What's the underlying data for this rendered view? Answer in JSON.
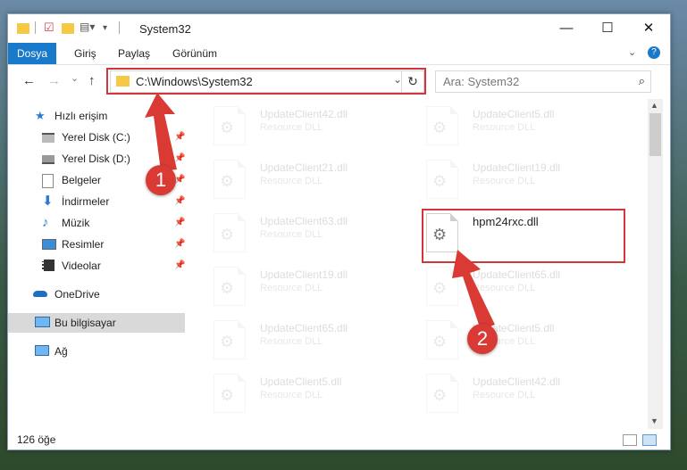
{
  "window": {
    "title": "System32",
    "controls": {
      "minimize": "—",
      "maximize": "☐",
      "close": "✕"
    }
  },
  "ribbon": {
    "tabs": [
      "Dosya",
      "Giriş",
      "Paylaş",
      "Görünüm"
    ],
    "expand_icon": "chevron-down-icon",
    "help_icon": "?"
  },
  "navigation": {
    "back": "←",
    "forward": "→",
    "recent": "⌄",
    "up": "↑",
    "address": "C:\\Windows\\System32",
    "address_dropdown": "⌄",
    "refresh": "↻",
    "search_placeholder": "Ara: System32"
  },
  "sidebar": {
    "items": [
      {
        "label": "Hızlı erişim",
        "icon": "star-icon",
        "pinned": false
      },
      {
        "label": "Yerel Disk (C:)",
        "icon": "drive-icon",
        "pinned": true
      },
      {
        "label": "Yerel Disk (D:)",
        "icon": "drive-icon",
        "pinned": true
      },
      {
        "label": "Belgeler",
        "icon": "documents-icon",
        "pinned": true
      },
      {
        "label": "İndirmeler",
        "icon": "download-icon",
        "pinned": true
      },
      {
        "label": "Müzik",
        "icon": "music-icon",
        "pinned": true
      },
      {
        "label": "Resimler",
        "icon": "pictures-icon",
        "pinned": true
      },
      {
        "label": "Videolar",
        "icon": "video-icon",
        "pinned": true
      },
      {
        "label": "OneDrive",
        "icon": "cloud-icon",
        "pinned": false
      },
      {
        "label": "Bu bilgisayar",
        "icon": "computer-icon",
        "pinned": false,
        "selected": true
      },
      {
        "label": "Ağ",
        "icon": "network-icon",
        "pinned": false
      }
    ]
  },
  "files": {
    "left_column": [
      {
        "name": "UpdateClient42.dll",
        "type": "Resource DLL"
      },
      {
        "name": "UpdateClient21.dll",
        "type": "Resource DLL"
      },
      {
        "name": "UpdateClient63.dll",
        "type": "Resource DLL"
      },
      {
        "name": "UpdateClient19.dll",
        "type": "Resource DLL"
      },
      {
        "name": "UpdateClient65.dll",
        "type": "Resource DLL"
      },
      {
        "name": "UpdateClient5.dll",
        "type": "Resource DLL"
      }
    ],
    "right_column": [
      {
        "name": "UpdateClient5.dll",
        "type": "Resource DLL"
      },
      {
        "name": "UpdateClient19.dll",
        "type": "Resource DLL"
      },
      {
        "name": "hpm24rxc.dll",
        "type": "",
        "highlighted": true
      },
      {
        "name": "UpdateClient65.dll",
        "type": "Resource DLL"
      },
      {
        "name": "UpdateClient5.dll",
        "type": "Resource DLL"
      },
      {
        "name": "UpdateClient42.dll",
        "type": "Resource DLL"
      }
    ]
  },
  "status": {
    "count": "126 öğe"
  },
  "annotations": {
    "badge1": "1",
    "badge2": "2",
    "color": "#d93a34"
  }
}
